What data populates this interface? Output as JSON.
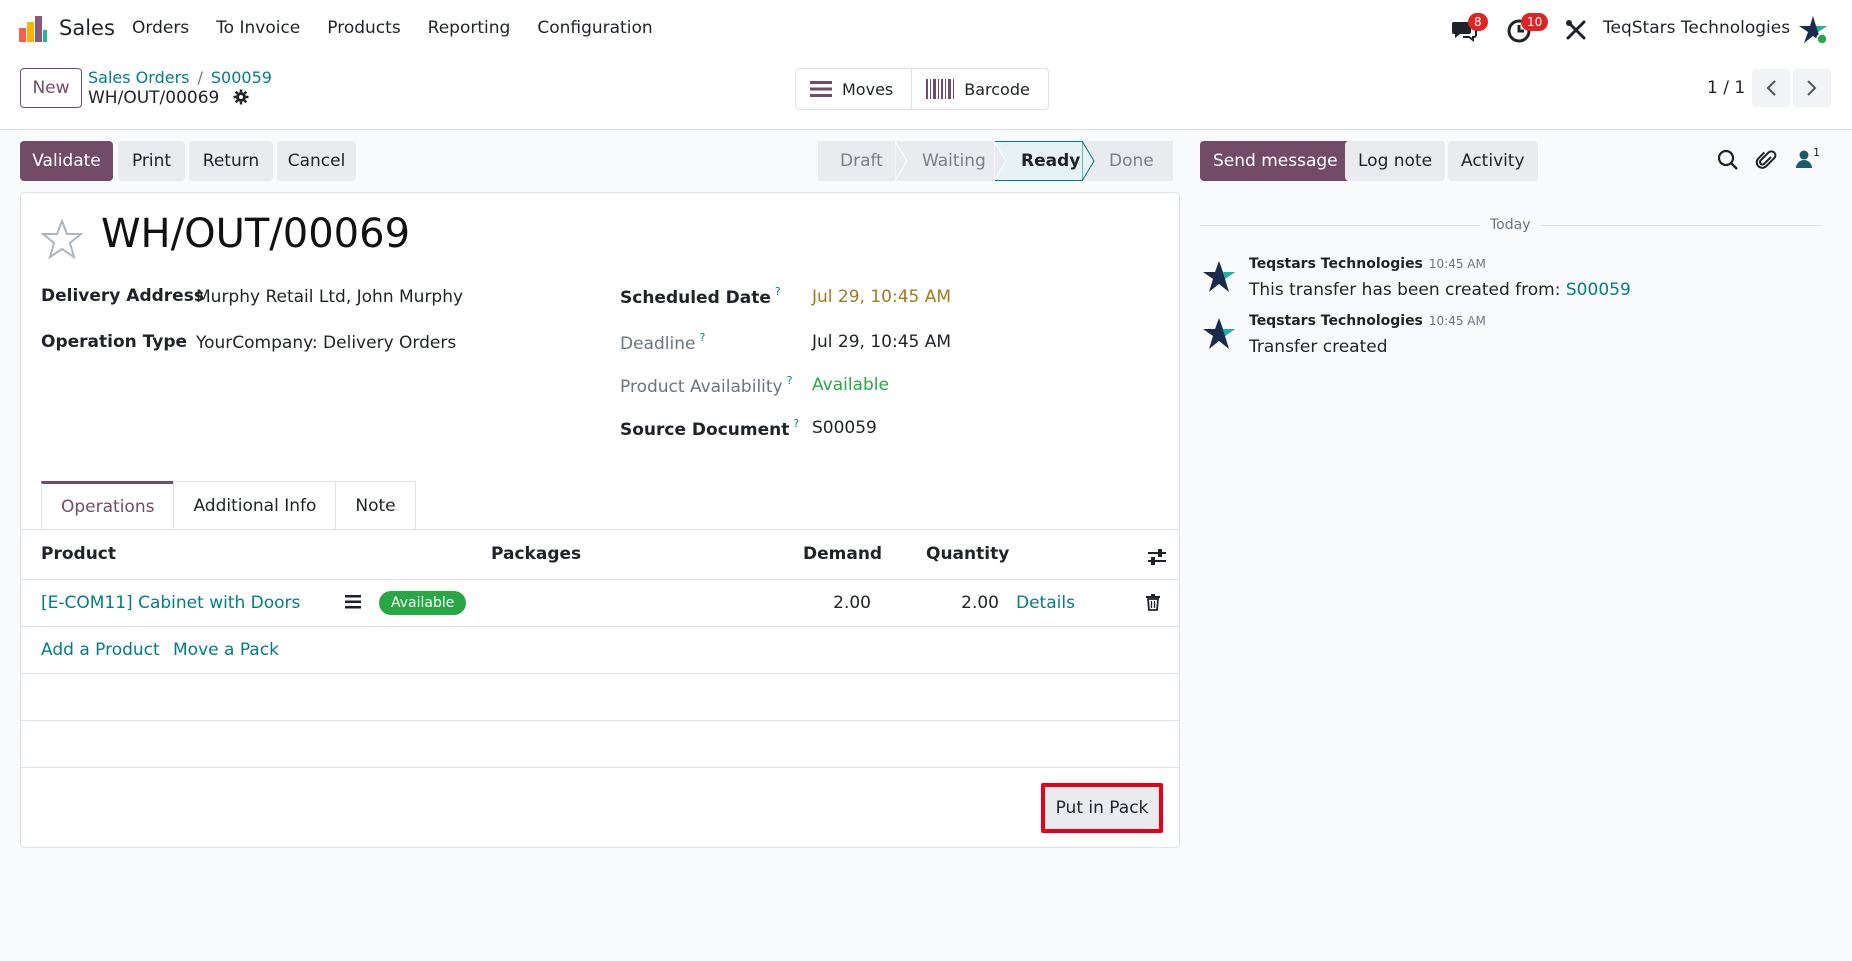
{
  "navbar": {
    "app_name": "Sales",
    "menu": [
      "Orders",
      "To Invoice",
      "Products",
      "Reporting",
      "Configuration"
    ],
    "messages_badge": "8",
    "activities_badge": "10",
    "company": "TeqStars Technologies"
  },
  "control_panel": {
    "new_label": "New",
    "breadcrumb": [
      "Sales Orders",
      "S00059"
    ],
    "record_name": "WH/OUT/00069",
    "smart_buttons": {
      "moves": "Moves",
      "barcode": "Barcode"
    },
    "pager": "1 / 1"
  },
  "actions": {
    "validate": "Validate",
    "print": "Print",
    "return": "Return",
    "cancel": "Cancel"
  },
  "statusbar": {
    "stages": [
      "Draft",
      "Waiting",
      "Ready",
      "Done"
    ],
    "current": "Ready"
  },
  "form": {
    "title": "WH/OUT/00069",
    "delivery_address_label": "Delivery Address",
    "delivery_address": "Murphy Retail Ltd, John Murphy",
    "operation_type_label": "Operation Type",
    "operation_type": "YourCompany: Delivery Orders",
    "scheduled_date_label": "Scheduled Date",
    "scheduled_date": "Jul 29, 10:45 AM",
    "deadline_label": "Deadline",
    "deadline": "Jul 29, 10:45 AM",
    "availability_label": "Product Availability",
    "availability": "Available",
    "source_label": "Source Document",
    "source": "S00059",
    "help_mark": "?"
  },
  "tabs": [
    "Operations",
    "Additional Info",
    "Note"
  ],
  "table": {
    "headers": {
      "product": "Product",
      "packages": "Packages",
      "demand": "Demand",
      "quantity": "Quantity"
    },
    "rows": [
      {
        "product": "[E-COM11] Cabinet with Doors",
        "status": "Available",
        "demand": "2.00",
        "quantity": "2.00",
        "details": "Details"
      }
    ],
    "add_product": "Add a Product",
    "move_pack": "Move a Pack"
  },
  "put_in_pack": "Put in Pack",
  "chatter": {
    "send_message": "Send message",
    "log_note": "Log note",
    "activity": "Activity",
    "followers_count": "1",
    "date_separator": "Today",
    "messages": [
      {
        "author": "Teqstars Technologies",
        "time": "10:45 AM",
        "body": "This transfer has been created from:",
        "link": "S00059"
      },
      {
        "author": "Teqstars Technologies",
        "time": "10:45 AM",
        "body": "Transfer created",
        "link": ""
      }
    ]
  },
  "colors": {
    "primary": "#714b67",
    "link": "#017e84",
    "success": "#28a745",
    "warning_text": "#a07b1b",
    "badge": "#e02424",
    "highlight_box": "#e8001b"
  }
}
